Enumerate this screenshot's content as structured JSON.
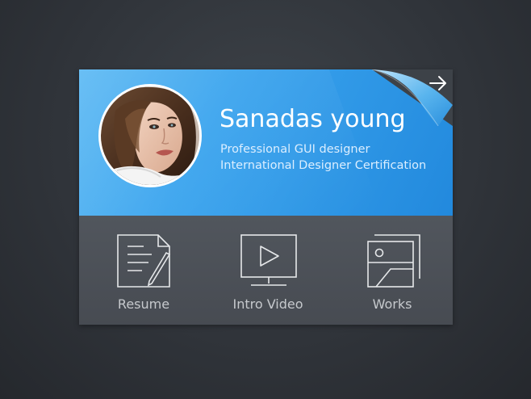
{
  "profile": {
    "name": "Sanadas young",
    "title_line1": "Professional GUI designer",
    "title_line2": "International Designer Certification",
    "avatar_icon": "avatar-portrait"
  },
  "corner": {
    "arrow_icon": "arrow-right-icon"
  },
  "actions": [
    {
      "label": "Resume",
      "icon": "document-edit-icon"
    },
    {
      "label": "Intro Video",
      "icon": "video-play-icon"
    },
    {
      "label": "Works",
      "icon": "image-gallery-icon"
    }
  ],
  "colors": {
    "header_start": "#5ab8f3",
    "header_end": "#2289dd",
    "footer": "#4c5057",
    "background": "#30343a",
    "icon_stroke": "#e6e8ea"
  }
}
